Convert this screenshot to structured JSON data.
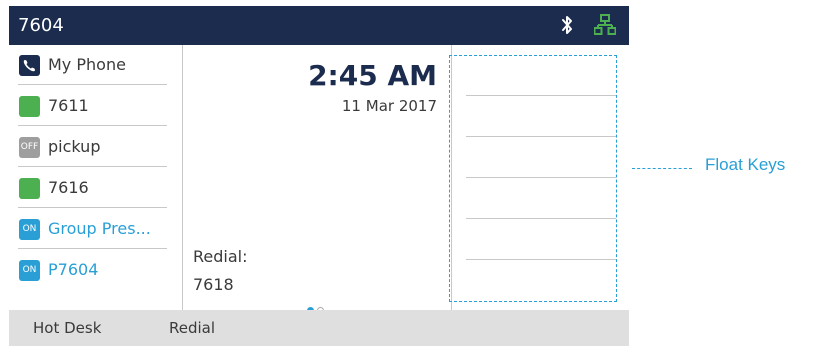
{
  "status_bar": {
    "extension": "7604",
    "icons": [
      "bluetooth-icon",
      "network-icon"
    ]
  },
  "line_keys": [
    {
      "icon": "phone-icon",
      "label": "My Phone",
      "color": "#1b2c4e"
    },
    {
      "icon": "green-status",
      "label": "7611",
      "color": "#4caf50"
    },
    {
      "icon_text": "OFF",
      "label": "pickup",
      "color": "#9e9e9e"
    },
    {
      "icon": "green-status",
      "label": "7616",
      "color": "#4caf50"
    },
    {
      "icon_text": "ON",
      "label": "Group Pres...",
      "color": "#2a9fd6"
    },
    {
      "icon_text": "ON",
      "label": "P7604",
      "color": "#2a9fd6"
    }
  ],
  "idle": {
    "time": "2:45 AM",
    "date": "11 Mar 2017",
    "redial_label": "Redial:",
    "redial_number": "7618",
    "page_indicator": {
      "current": 1,
      "total": 2
    }
  },
  "softkeys": [
    "Hot Desk",
    "Redial"
  ],
  "callout": {
    "label": "Float Keys"
  },
  "colors": {
    "header": "#1b2c4e",
    "accent": "#2a9fd6",
    "presence_green": "#4caf50",
    "softkey_bar": "#dfdfdf"
  }
}
